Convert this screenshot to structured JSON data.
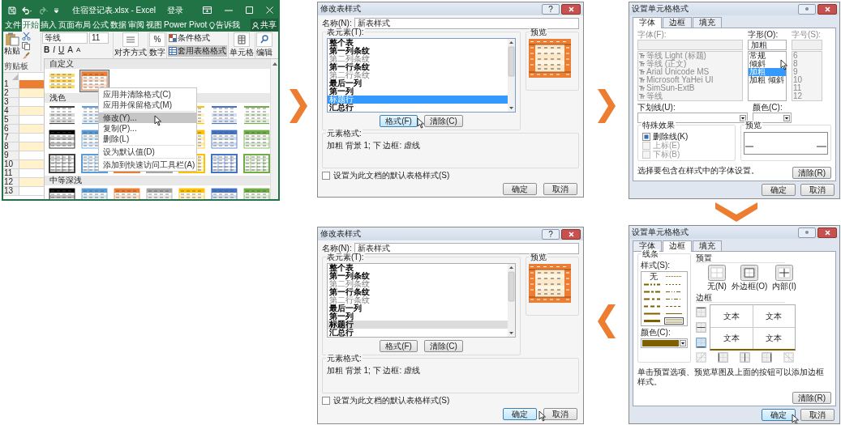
{
  "excel": {
    "title": "住宿登记表.xlsx - Excel",
    "signin": "登录",
    "tabs": [
      {
        "label": "文件",
        "selected": false
      },
      {
        "label": "开始",
        "selected": true
      },
      {
        "label": "插入",
        "selected": false
      },
      {
        "label": "页面布局",
        "selected": false
      },
      {
        "label": "公式",
        "selected": false
      },
      {
        "label": "数据",
        "selected": false
      },
      {
        "label": "审阅",
        "selected": false
      },
      {
        "label": "视图",
        "selected": false
      },
      {
        "label": "Power Pivot",
        "selected": false
      }
    ],
    "tell_me": "告诉我",
    "share": "共享",
    "ribbon": {
      "paste": "粘贴",
      "clipboard": "剪贴板",
      "font_name": "等线",
      "font_size": "11",
      "bold": "B",
      "italic": "I",
      "underline": "U",
      "grow": "A",
      "shrink": "A",
      "align": "对齐方式",
      "percent": "%",
      "number": "数字",
      "conditional": "条件格式",
      "table_format": "套用表格格式",
      "cells": "单元格",
      "edit": "编辑"
    },
    "rows": [
      {
        "number": "1",
        "color": "#ed7d31"
      },
      {
        "number": "2",
        "color": "#fff2cc"
      },
      {
        "number": "3",
        "color": "#ffffff"
      },
      {
        "number": "4",
        "color": "#fff2cc"
      },
      {
        "number": "5",
        "color": "#ffffff"
      },
      {
        "number": "6",
        "color": "#fff2cc"
      },
      {
        "number": "7",
        "color": "#ffffff"
      },
      {
        "number": "8",
        "color": "#fff2cc"
      },
      {
        "number": "9",
        "color": "#ffffff"
      },
      {
        "number": "10",
        "color": "#fff2cc"
      },
      {
        "number": "11",
        "color": "#ffffff"
      },
      {
        "number": "12",
        "color": "#fff2cc"
      },
      {
        "number": "13",
        "color": "#ffffff"
      }
    ],
    "gallery": [
      {
        "title": "自定义",
        "rows": [
          [
            {
              "kind": "banded",
              "color": "#ffd966",
              "selected": false
            },
            {
              "kind": "header",
              "color": "#ed7d31",
              "selected": true
            }
          ]
        ]
      },
      {
        "title": "浅色",
        "rows": [
          [
            {
              "kind": "lines",
              "color": "#404040",
              "selected": false
            },
            {
              "kind": "lines",
              "color": "#5b9bd5",
              "selected": false
            },
            {
              "kind": "lines",
              "color": "#ffc000",
              "selected": false
            },
            {
              "kind": "lines",
              "color": "#4472c4",
              "selected": false
            },
            {
              "kind": "lines",
              "color": "#70ad47",
              "selected": false
            }
          ],
          [
            {
              "kind": "header",
              "color": "#000000",
              "selected": false
            },
            {
              "kind": "header",
              "color": "#5b9bd5",
              "selected": false
            },
            {
              "kind": "header",
              "color": "#ffc000",
              "selected": false
            },
            {
              "kind": "header",
              "color": "#4472c4",
              "selected": false
            },
            {
              "kind": "header",
              "color": "#70ad47",
              "selected": false
            }
          ],
          [
            {
              "kind": "grid",
              "color": "#404040",
              "selected": false
            },
            {
              "kind": "grid",
              "color": "#5b9bd5",
              "selected": false
            },
            {
              "kind": "grid",
              "color": "#ed7d31",
              "selected": false
            },
            {
              "kind": "grid",
              "color": "#a5a5a5",
              "selected": false
            },
            {
              "kind": "grid",
              "color": "#ffc000",
              "selected": false
            },
            {
              "kind": "grid",
              "color": "#4472c4",
              "selected": false
            },
            {
              "kind": "grid",
              "color": "#70ad47",
              "selected": false
            }
          ]
        ]
      },
      {
        "title": "中等深浅",
        "rows": [
          [
            {
              "kind": "header",
              "color": "#000000",
              "selected": false
            },
            {
              "kind": "header",
              "color": "#5b9bd5",
              "selected": false
            },
            {
              "kind": "header",
              "color": "#ed7d31",
              "selected": false
            },
            {
              "kind": "header",
              "color": "#a5a5a5",
              "selected": false
            },
            {
              "kind": "header",
              "color": "#ffc000",
              "selected": false
            },
            {
              "kind": "header",
              "color": "#4472c4",
              "selected": false
            },
            {
              "kind": "header",
              "color": "#70ad47",
              "selected": false
            }
          ]
        ]
      }
    ],
    "context_menu": [
      {
        "label": "应用并清除格式(C)",
        "selected": false,
        "divider": false
      },
      {
        "label": "应用并保留格式(M)",
        "selected": false,
        "divider": true
      },
      {
        "label": "修改(Y)...",
        "selected": true,
        "divider": false
      },
      {
        "label": "复制(P)...",
        "selected": false,
        "divider": false
      },
      {
        "label": "删除(L)",
        "selected": false,
        "divider": true
      },
      {
        "label": "设为默认值(D)",
        "selected": false,
        "divider": true
      },
      {
        "label": "添加到快速访问工具栏(A)",
        "selected": false,
        "divider": false
      }
    ]
  },
  "modify_dialogs": [
    {
      "title": "修改表样式",
      "help": "?",
      "name_label": "名称(N):",
      "name_value": "新表样式",
      "elements_label": "表元素(T):",
      "list_focused": true,
      "elements": [
        {
          "label": "整个表",
          "formatted": true,
          "selected": false
        },
        {
          "label": "第一列条纹",
          "formatted": true,
          "selected": false
        },
        {
          "label": "第二列条纹",
          "formatted": false,
          "selected": false
        },
        {
          "label": "第一行条纹",
          "formatted": true,
          "selected": false
        },
        {
          "label": "第二行条纹",
          "formatted": false,
          "selected": false
        },
        {
          "label": "最后一列",
          "formatted": true,
          "selected": false
        },
        {
          "label": "第一列",
          "formatted": true,
          "selected": false
        },
        {
          "label": "标题行",
          "formatted": true,
          "selected": true
        },
        {
          "label": "汇总行",
          "formatted": true,
          "selected": false
        }
      ],
      "format_button": {
        "label": "格式(F)",
        "hover": true
      },
      "clear_button": "清除(C)",
      "preview_label": "预览",
      "element_format_label": "元素格式:",
      "element_format": "加粗 背景 1; 下 边框: 虚线",
      "default_checkbox": {
        "label": "设置为此文档的默认表格样式(S)",
        "checked": false
      },
      "ok_button": {
        "label": "确定",
        "hover": false
      },
      "cancel_button": "取消"
    },
    {
      "title": "修改表样式",
      "help": "?",
      "name_label": "名称(N):",
      "name_value": "新表样式",
      "elements_label": "表元素(T):",
      "list_focused": false,
      "elements": [
        {
          "label": "整个表",
          "formatted": true,
          "selected": false
        },
        {
          "label": "第一列条纹",
          "formatted": true,
          "selected": false
        },
        {
          "label": "第二列条纹",
          "formatted": false,
          "selected": false
        },
        {
          "label": "第一行条纹",
          "formatted": true,
          "selected": false
        },
        {
          "label": "第二行条纹",
          "formatted": false,
          "selected": false
        },
        {
          "label": "最后一列",
          "formatted": true,
          "selected": false
        },
        {
          "label": "第一列",
          "formatted": true,
          "selected": false
        },
        {
          "label": "标题行",
          "formatted": true,
          "selected": true
        },
        {
          "label": "汇总行",
          "formatted": true,
          "selected": false
        }
      ],
      "format_button": {
        "label": "格式(F)",
        "hover": false
      },
      "clear_button": "清除(C)",
      "preview_label": "预览",
      "element_format_label": "元素格式:",
      "element_format": "加粗 背景 1; 下 边框: 虚线",
      "default_checkbox": {
        "label": "设置为此文档的默认表格样式(S)",
        "checked": false
      },
      "ok_button": {
        "label": "确定",
        "hover": true
      },
      "cancel_button": "取消"
    }
  ],
  "font_dialog": {
    "title": "设置单元格格式",
    "tabs": [
      {
        "label": "字体",
        "selected": true
      },
      {
        "label": "边框",
        "selected": false
      },
      {
        "label": "填充",
        "selected": false
      }
    ],
    "font": {
      "label": "字体(F):",
      "disabled": true,
      "items": [
        "等线 Light (标题)",
        "等线 (正文)",
        "Arial Unicode MS",
        "Microsoft YaHei UI",
        "SimSun-ExtB",
        "等线"
      ]
    },
    "style": {
      "label": "字形(O):",
      "value": "加粗",
      "items": [
        {
          "label": "常规",
          "selected": false
        },
        {
          "label": "倾斜",
          "selected": false
        },
        {
          "label": "加粗",
          "selected": true
        },
        {
          "label": "加粗 倾斜",
          "selected": false
        }
      ]
    },
    "size": {
      "label": "字号(S):",
      "disabled": true,
      "items": [
        "6",
        "8",
        "9",
        "10",
        "11",
        "12"
      ]
    },
    "underline_label": "下划线(U):",
    "color_label": "颜色(C):",
    "effects_label": "特殊效果",
    "effects": [
      {
        "label": "删除线(K)",
        "checked": true,
        "disabled": false
      },
      {
        "label": "上标(E)",
        "checked": false,
        "disabled": true
      },
      {
        "label": "下标(B)",
        "checked": false,
        "disabled": true
      }
    ],
    "preview_label": "预览",
    "description": "选择要包含在样式中的字体设置。",
    "clear_button": "清除(R)",
    "ok_button": "确定",
    "cancel_button": "取消"
  },
  "border_dialog": {
    "title": "设置单元格格式",
    "tabs": [
      {
        "label": "字体",
        "selected": false
      },
      {
        "label": "边框",
        "selected": true
      },
      {
        "label": "填充",
        "selected": false
      }
    ],
    "line_label": "线条",
    "style_label": "样式(S):",
    "none_style": "无",
    "line_styles": [
      {
        "kind": "hair",
        "selected": false
      },
      {
        "kind": "medium-dash-dot-dot",
        "selected": false
      },
      {
        "kind": "dotted",
        "selected": false
      },
      {
        "kind": "slant-dash-dot",
        "selected": false
      },
      {
        "kind": "dash-dot-dot",
        "selected": false
      },
      {
        "kind": "medium-dash-dot",
        "selected": false
      },
      {
        "kind": "dash-dot",
        "selected": false
      },
      {
        "kind": "medium-dashed",
        "selected": false
      },
      {
        "kind": "dashed",
        "selected": false
      },
      {
        "kind": "medium",
        "selected": false
      },
      {
        "kind": "thin",
        "selected": false
      },
      {
        "kind": "thick",
        "selected": false
      },
      {
        "kind": "double",
        "selected": true
      }
    ],
    "color_label": "颜色(C):",
    "color": "#7f6000",
    "presets_label": "预置",
    "presets": [
      {
        "kind": "none",
        "label": "无(N)"
      },
      {
        "kind": "outline",
        "label": "外边框(O)"
      },
      {
        "kind": "inside",
        "label": "内部(I)"
      }
    ],
    "border_label": "边框",
    "cell_text": [
      "文本",
      "文本",
      "文本",
      "文本"
    ],
    "side_buttons": [
      {
        "kind": "top",
        "selected": false
      },
      {
        "kind": "middle",
        "selected": false
      },
      {
        "kind": "bottom",
        "selected": true
      }
    ],
    "bottom_buttons": [
      {
        "kind": "diag-up",
        "disabled": true
      },
      {
        "kind": "left",
        "disabled": false
      },
      {
        "kind": "center",
        "disabled": false
      },
      {
        "kind": "right",
        "disabled": false
      },
      {
        "kind": "diag-down",
        "disabled": true
      }
    ],
    "description": "单击预置选项、预览草图及上面的按钮可以添加边框样式。",
    "clear_button": "清除(R)",
    "ok_button": "确定",
    "cancel_button": "取消"
  }
}
